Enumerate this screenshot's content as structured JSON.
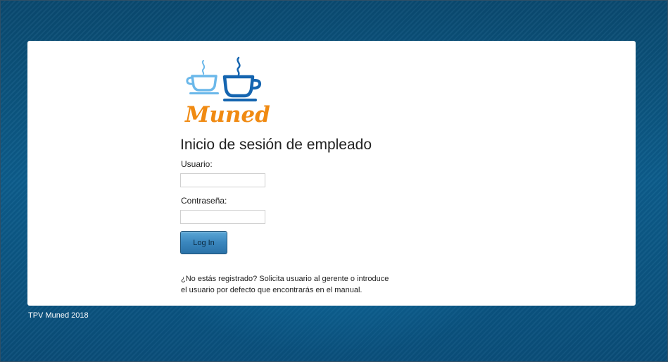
{
  "brand": {
    "logo_text": "Muned",
    "colors": {
      "cup_light": "#6bb8ea",
      "cup_dark": "#1565b0",
      "text_orange": "#f08a12"
    }
  },
  "login": {
    "title": "Inicio de sesión de empleado",
    "username_label": "Usuario:",
    "username_value": "",
    "password_label": "Contraseña:",
    "password_value": "",
    "button_label": "Log In",
    "note_line1": "¿No estás registrado? Solicita usuario al gerente o introduce",
    "note_line2": "el usuario por defecto que encontrarás en el manual."
  },
  "footer": {
    "text": "TPV Muned 2018"
  },
  "theme": {
    "background": "#0c5d8c",
    "card": "#ffffff",
    "button": "#3a86bd"
  }
}
